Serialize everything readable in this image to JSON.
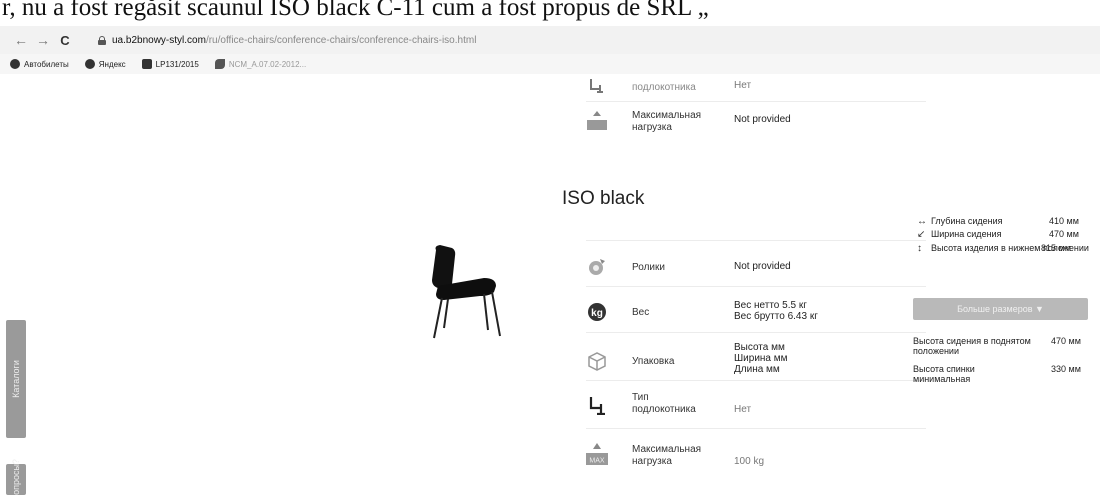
{
  "doc_header": "r, nu a fost regăsit scaunul ISO black C-11 cum a fost propus de SRL „",
  "browser": {
    "back": "←",
    "forward": "→",
    "reload": "C",
    "url_host": "ua.b2bnowy-styl.com",
    "url_path": "/ru/office-chairs/conference-chairs/conference-chairs-iso.html",
    "bookmarks": [
      "Автобилеты",
      "Яндекс",
      "LP131/2015",
      "NCM_A.07.02-2012..."
    ]
  },
  "top_specs": [
    {
      "label": "подлокотника",
      "value": "Нет"
    },
    {
      "label": "Максимальная нагрузка",
      "value": "Not provided"
    }
  ],
  "product_title": "ISO black",
  "specs": [
    {
      "label": "Ролики",
      "value": "Not provided"
    },
    {
      "label": "Вес",
      "value_lines": [
        "Вес нетто 5.5 кг",
        "Вес брутто 6.43 кг"
      ]
    },
    {
      "label": "Упаковка",
      "value_lines": [
        "Высота мм",
        "Ширина мм",
        "Длина мм"
      ]
    },
    {
      "label": "Тип подлокотника",
      "value": "Нет"
    },
    {
      "label": "Максимальная нагрузка",
      "value": "100 kg"
    }
  ],
  "max_badge": "MAX",
  "dimensions": [
    {
      "icon": "↔",
      "label": "Глубина сидения",
      "value": "410 мм"
    },
    {
      "icon": "↙",
      "label": "Ширина сидения",
      "value": "470 мм"
    },
    {
      "icon": "↕",
      "label": "Высота изделия в нижнем положении",
      "value": "815 мм"
    }
  ],
  "more_button": "Больше размеров ▼",
  "more_dimensions": [
    {
      "label": "Высота сидения в поднятом положении",
      "value": "470 мм"
    },
    {
      "label": "Высота спинки минимальная",
      "value": "330 мм"
    }
  ],
  "side_tabs": [
    "Каталоги",
    "Вопросы?"
  ]
}
